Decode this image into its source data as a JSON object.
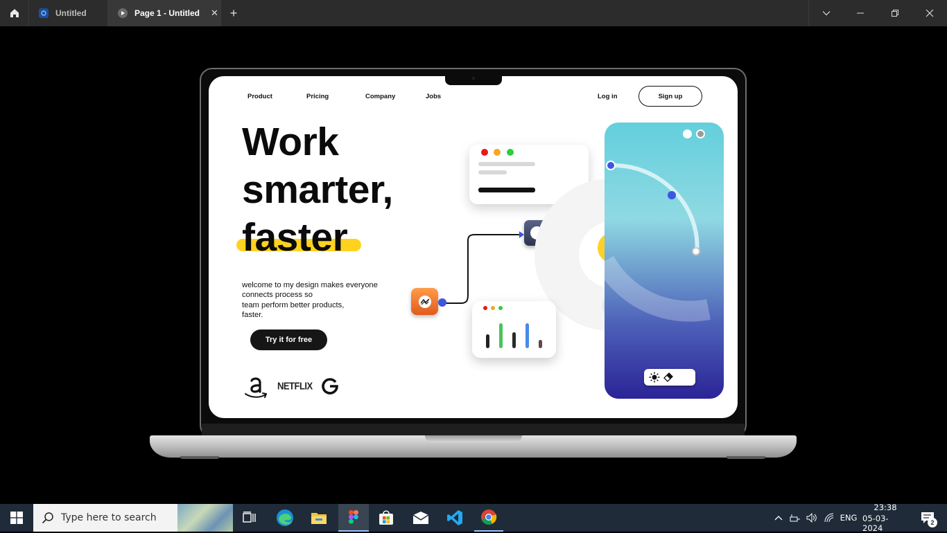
{
  "window": {
    "tabs": [
      {
        "label": "Untitled",
        "active": false
      },
      {
        "label": "Page 1 - Untitled",
        "active": true
      }
    ],
    "close_tab": "✕",
    "add_tab": "+"
  },
  "design": {
    "nav": {
      "items": [
        "Product",
        "Pricing",
        "Company",
        "Jobs"
      ],
      "login": "Log in",
      "signup": "Sign up"
    },
    "hero": {
      "line1": "Work",
      "line2": "smarter,",
      "line3": "faster"
    },
    "description": "welcome  to my design makes everyone\nconnects process so\nteam perform better products,\nfaster.",
    "cta": "Try it for free",
    "brands": [
      "amazon-logo",
      "NETFLIX",
      "google-logo"
    ],
    "colors": {
      "highlight": "#ffd21f",
      "accent_blue": "#3d57e0",
      "orange": "#f07a2a",
      "cta_bg": "#161616"
    },
    "chart_bars": [
      {
        "value": 0.45,
        "color": "#222222"
      },
      {
        "value": 0.82,
        "color": "#4cc25a"
      },
      {
        "value": 0.52,
        "color": "#2a2a2a"
      },
      {
        "value": 0.82,
        "color": "#4a8ae8"
      },
      {
        "value": 0.28,
        "color": "#5a4a4a"
      }
    ]
  },
  "taskbar": {
    "search_placeholder": "Type here to search",
    "apps": [
      "task-view-icon",
      "edge-icon",
      "file-explorer-icon",
      "figma-icon",
      "store-icon",
      "mail-icon",
      "vscode-icon",
      "chrome-icon"
    ],
    "language": "ENG",
    "time": "23:38",
    "date": "05-03-2024",
    "notifications": "2"
  }
}
